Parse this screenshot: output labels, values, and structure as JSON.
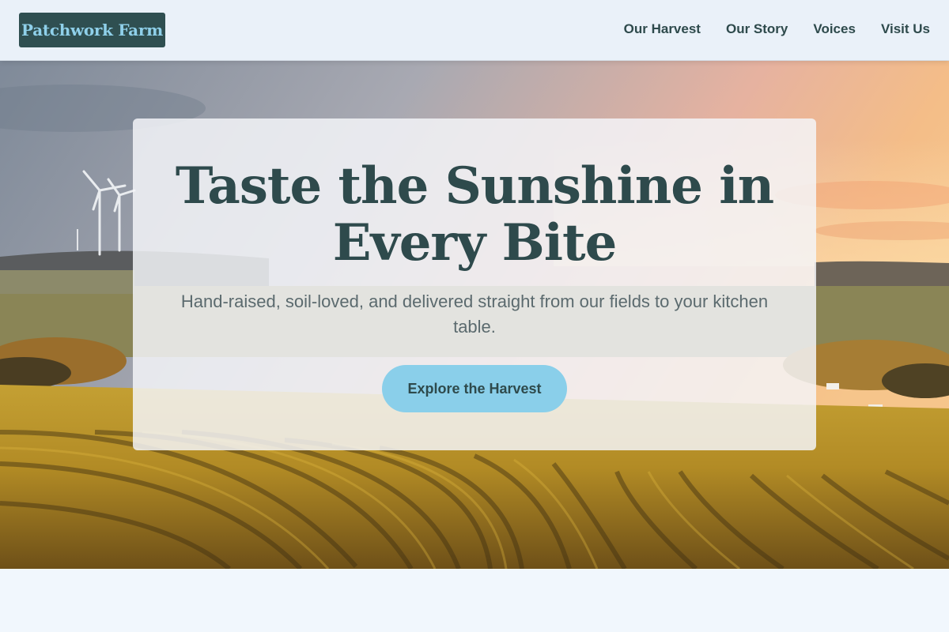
{
  "header": {
    "logo_text": "Patchwork Farm",
    "nav": [
      {
        "label": "Our Harvest"
      },
      {
        "label": "Our Story"
      },
      {
        "label": "Voices"
      },
      {
        "label": "Visit Us"
      }
    ]
  },
  "hero": {
    "title": "Taste the Sunshine in Every Bite",
    "subtitle": "Hand-raised, soil-loved, and delivered straight from our fields to your kitchen table.",
    "cta_label": "Explore the Harvest"
  },
  "colors": {
    "brand_dark": "#2f4f51",
    "brand_accent": "#8acfea",
    "page_background": "#f1f7fd"
  }
}
